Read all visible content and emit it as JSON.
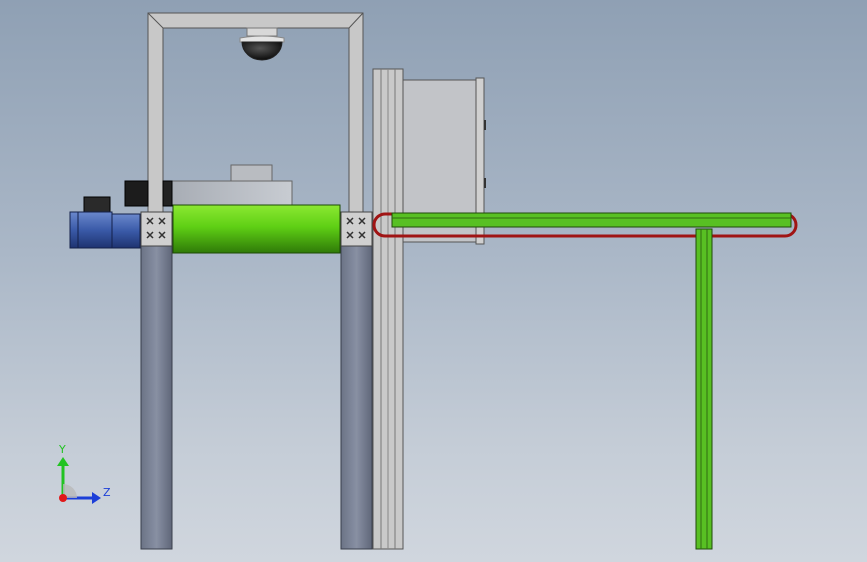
{
  "view": {
    "background_top": "#8fa0b4",
    "background_bottom": "#d0d6de"
  },
  "triad": {
    "y_label": "Y",
    "z_label": "Z",
    "y_color": "#22c322",
    "z_color": "#1c3fd8",
    "origin_color": "#e01818"
  },
  "colors": {
    "roller": "#5fd015",
    "side_conveyor": "#58c023",
    "belt": "#a01414",
    "frame_gray": "#c4c4c4",
    "leg": "#7b8397",
    "motor": "#3a5aa8"
  }
}
